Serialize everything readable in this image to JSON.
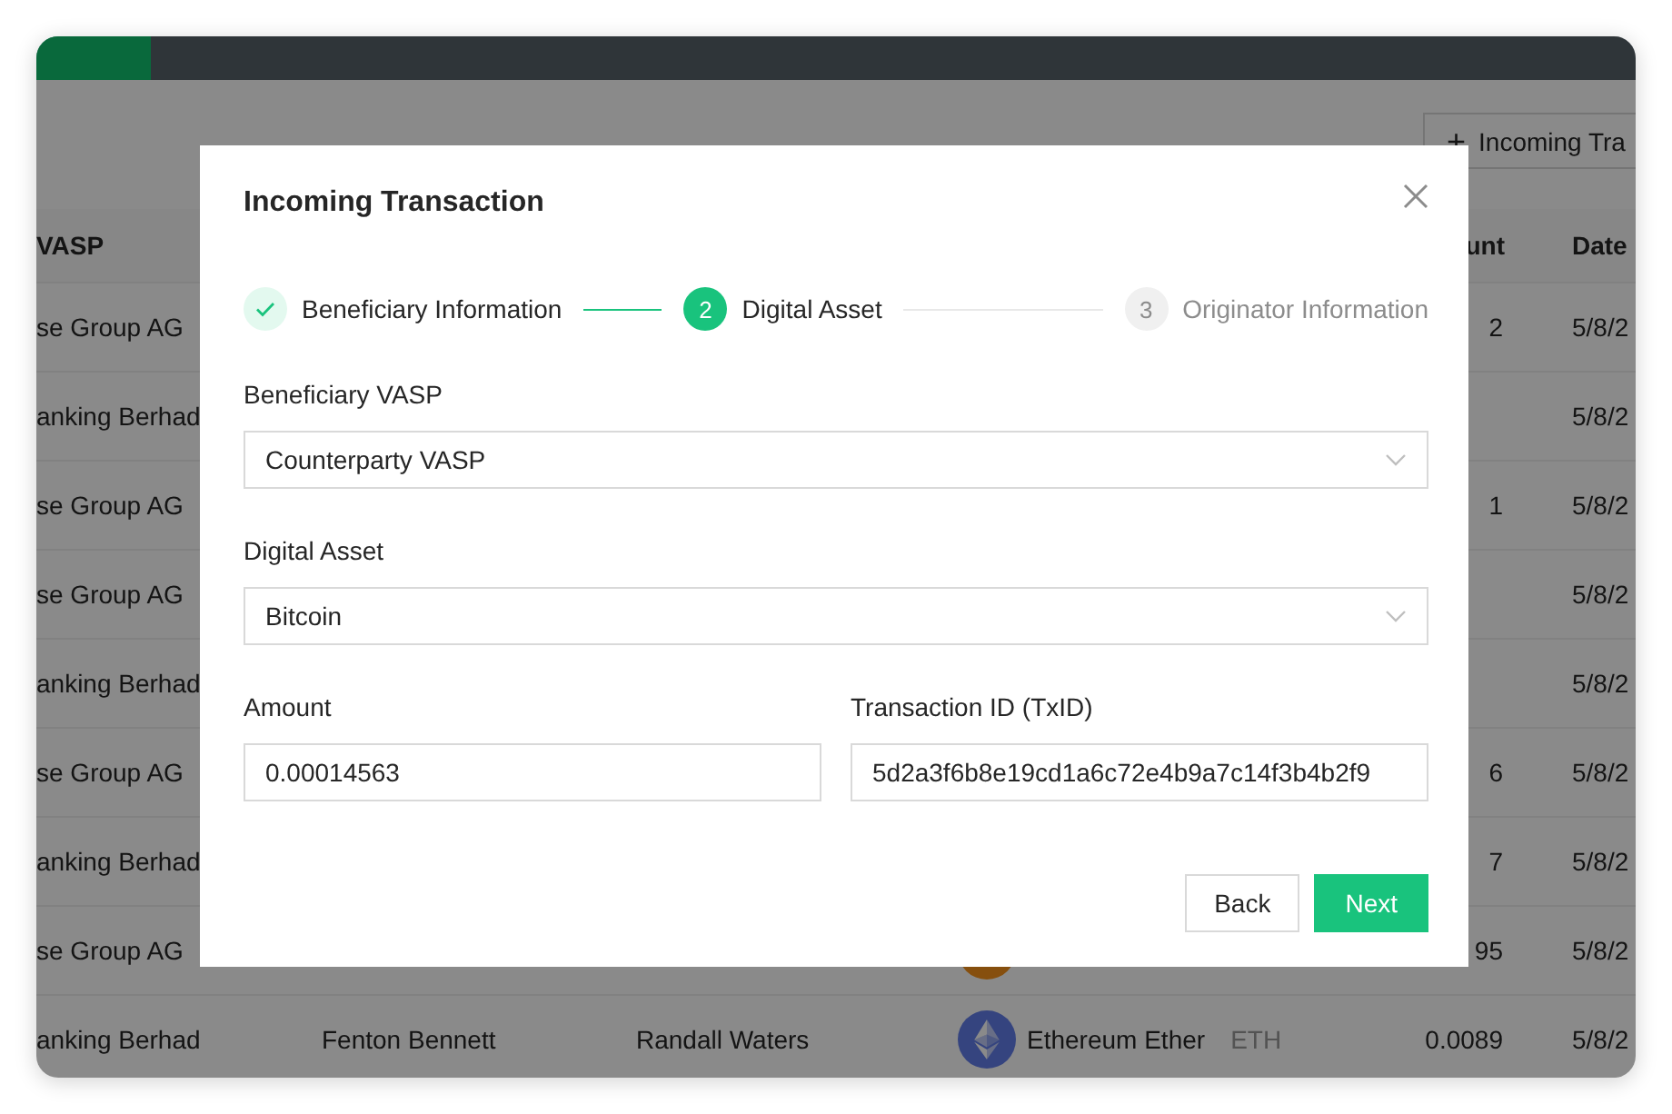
{
  "toolbar": {
    "new_button": {
      "icon": "+",
      "label": "Incoming Tra"
    }
  },
  "table": {
    "columns": [
      {
        "label": "VASP"
      },
      {
        "label": "unt"
      },
      {
        "label": "Date"
      }
    ],
    "rows": [
      {
        "vasp": "se Group AG",
        "amount": "2",
        "date": "5/8/2"
      },
      {
        "vasp": "anking Berhad",
        "date": "5/8/2"
      },
      {
        "vasp": "se Group AG",
        "amount": "1",
        "date": "5/8/2"
      },
      {
        "vasp": "se Group AG",
        "date": "5/8/2"
      },
      {
        "vasp": "anking Berhad",
        "date": "5/8/2"
      },
      {
        "vasp": "se Group AG",
        "amount": "6",
        "date": "5/8/2"
      },
      {
        "vasp": "anking Berhad",
        "amount": "7",
        "date": "5/8/2"
      },
      {
        "vasp": "se Group AG",
        "kind": "coin",
        "amount": "95",
        "date": "5/8/2"
      },
      {
        "vasp": "anking Berhad",
        "column_2": "Fenton Bennett",
        "column_3": "Randall Waters",
        "kind": "ethereum",
        "asset": "Ethereum Ether",
        "symbol": "ETH",
        "amount": "0.0089",
        "date": "5/8/2"
      }
    ]
  },
  "modal": {
    "title": "Incoming Transaction",
    "steps": [
      {
        "completed": true,
        "selected": false,
        "label": "Beneficiary Information"
      },
      {
        "completed": false,
        "selected": true,
        "number": "2",
        "label": "Digital Asset"
      },
      {
        "completed": false,
        "selected": false,
        "number": "3",
        "label": "Originator Information"
      }
    ],
    "form_rows": [
      [
        {
          "label": "Beneficiary VASP",
          "kind": "select",
          "value": "Counterparty VASP"
        }
      ],
      [
        {
          "label": "Digital Asset",
          "kind": "select",
          "value": "Bitcoin"
        }
      ],
      [
        {
          "label": "Amount",
          "kind": "input",
          "value": "0.00014563"
        },
        {
          "label": "Transaction ID (TxID)",
          "kind": "input",
          "value": "5d2a3f6b8e19cd1a6c72e4b9a7c14f3b4b2f9"
        }
      ]
    ],
    "buttons": [
      {
        "label": "Back",
        "kind": "default"
      },
      {
        "label": "Next",
        "kind": "primary"
      }
    ]
  }
}
